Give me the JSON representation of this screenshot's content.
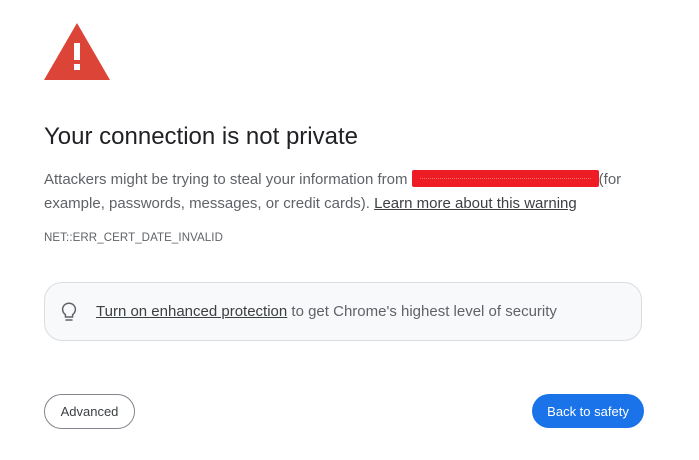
{
  "heading": {
    "title": "Your connection is not private"
  },
  "message": {
    "text_before": "Attackers might be trying to steal your information from ",
    "redacted_host": "",
    "text_after": "(for example, passwords, messages, or credit cards). ",
    "learn_more_link": "Learn more about this warning"
  },
  "error_code": "NET::ERR_CERT_DATE_INVALID",
  "enhanced_protection": {
    "icon": "lightbulb-icon",
    "link_text": "Turn on enhanced protection",
    "text_after": " to get Chrome's highest level of security"
  },
  "buttons": {
    "advanced_label": "Advanced",
    "back_label": "Back to safety"
  },
  "colors": {
    "warning_red": "#db4437",
    "primary_blue": "#1a73e8",
    "redaction": "#ee1c24"
  },
  "icons": {
    "warning": "warning-triangle-icon"
  }
}
